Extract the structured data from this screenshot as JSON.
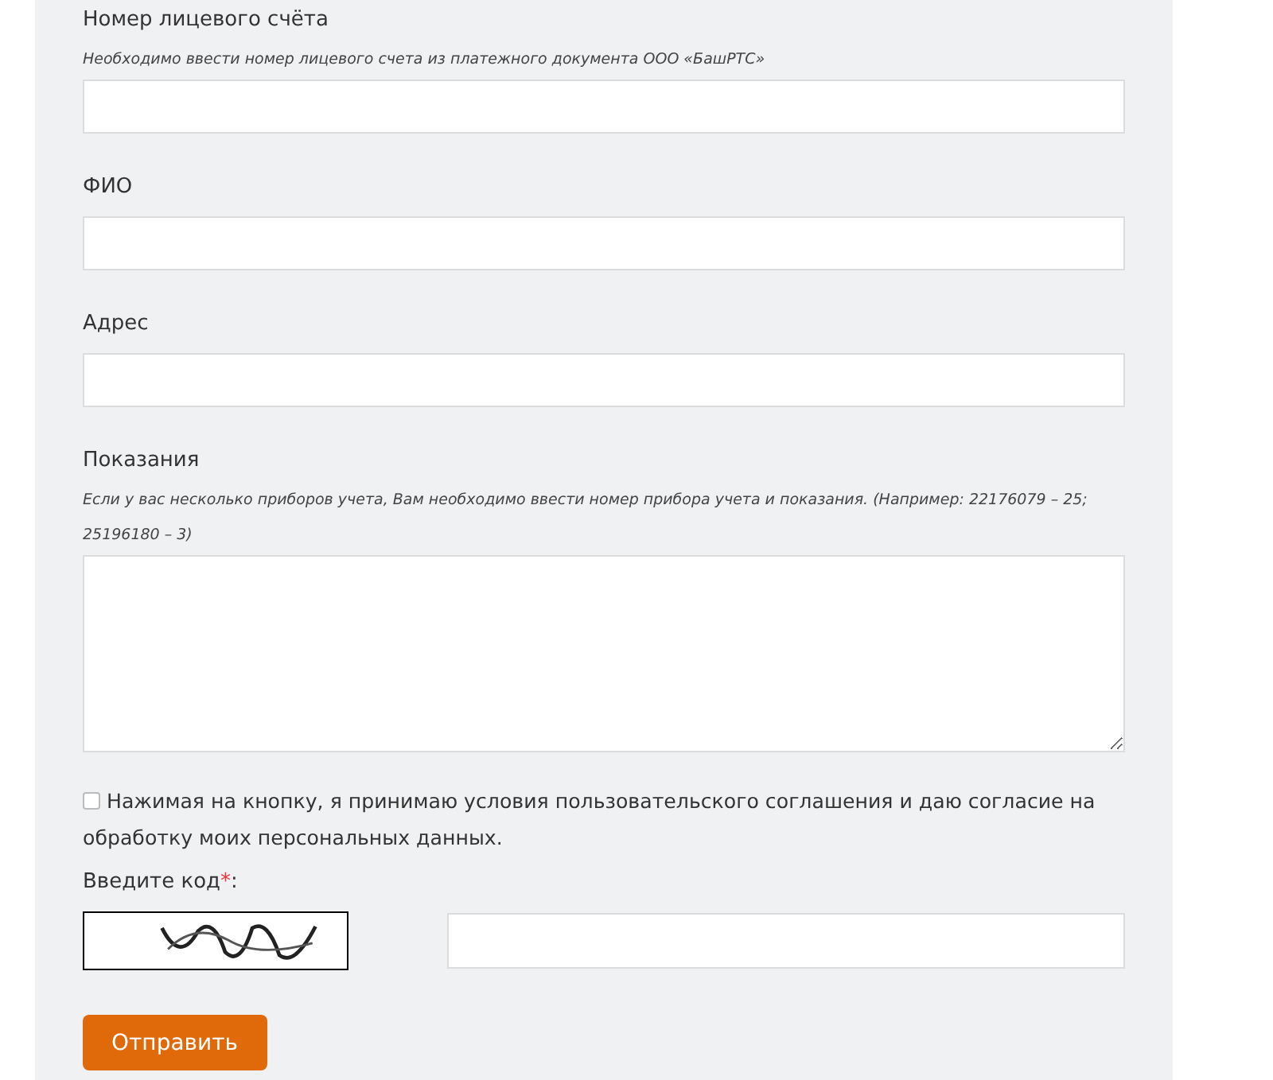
{
  "fields": [
    {
      "kind": "text",
      "label": "Номер лицевого счёта",
      "hint": "Необходимо ввести номер лицевого счета из платежного документа ООО «БашРТС»"
    },
    {
      "kind": "text",
      "label": "ФИО"
    },
    {
      "kind": "text",
      "label": "Адрес"
    },
    {
      "kind": "textarea",
      "label": "Показания",
      "hint": "Если у вас несколько приборов учета, Вам необходимо ввести номер прибора учета и показания. (Например: 22176079 – 25; 25196180 – 3)"
    }
  ],
  "consent": {
    "checked": false,
    "text": "Нажимая на кнопку, я принимаю условия пользовательского соглашения и даю согласие на обработку моих персональных данных."
  },
  "captcha": {
    "label": "Введите код",
    "required_mark": "*",
    "suffix": ":"
  },
  "submit": {
    "label": "Отправить"
  }
}
